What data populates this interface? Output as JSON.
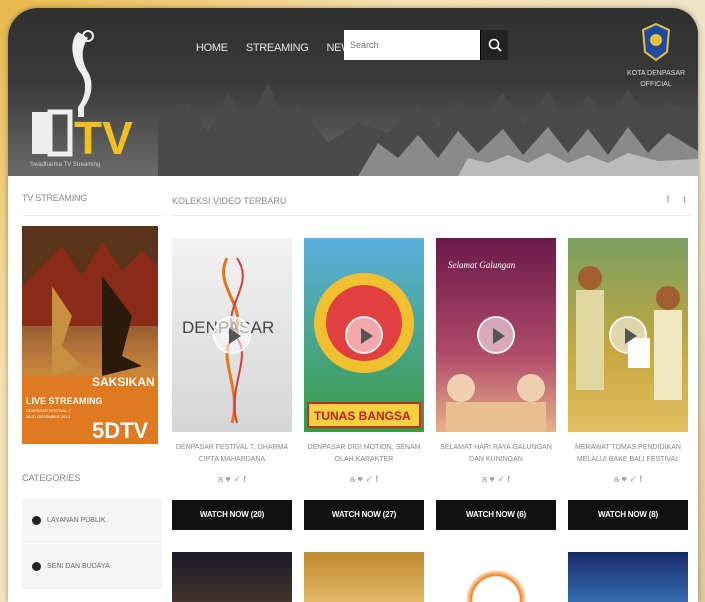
{
  "header": {
    "logo_text": "5DTV",
    "logo_sub": "Swadharma TV Streaming",
    "nav": [
      "HOME",
      "STREAMING",
      "NEWS"
    ],
    "search_placeholder": "Search",
    "badge_text_1": "KOTA DENPASAR",
    "badge_text_2": "OFFICIAL"
  },
  "sidebar": {
    "tv_streaming_title": "TV STREAMING",
    "stream_banner": {
      "headline": "SAKSIKAN",
      "line1": "LIVE STREAMING",
      "line2": "DENPASAR FESTIVAL 7",
      "line3": "28-31 DESEMBER 2014",
      "logo": "5DTV"
    },
    "categories_title": "CATEGORIES",
    "categories": [
      "LAYANAN PUBLIK",
      "SENI DAN BUDAYA"
    ]
  },
  "main": {
    "title": "KOLEKSI VIDEO TERBARU",
    "social": [
      "f",
      "t"
    ],
    "cards": [
      {
        "title": "DENPASAR FESTIVAL 7, DHARMA CIPTA MAHARDANA",
        "watch": "WATCH NOW (20)",
        "thumb_text": "DENPASAR"
      },
      {
        "title": "DENPASAR DIGI MOTION, SENAM OLAH KARAKTER",
        "watch": "WATCH NOW (27)",
        "thumb_text": "TUNAS BANGSA"
      },
      {
        "title": "SELAMAT HARI RAYA GALUNGAN DAN KUNINGAN",
        "watch": "WATCH NOW (6)",
        "thumb_text": "Selamat Galungan"
      },
      {
        "title": "MERAWAT TOMAS PENDIDIKAN MELALUI BAKE BALI FESTIVAL",
        "watch": "WATCH NOW (8)",
        "thumb_text": ""
      }
    ],
    "card_social": "a  ♥  ✓  f"
  },
  "colors": {
    "header_bg": "#333333",
    "button_bg": "#111111",
    "accent": "#e08a28"
  }
}
